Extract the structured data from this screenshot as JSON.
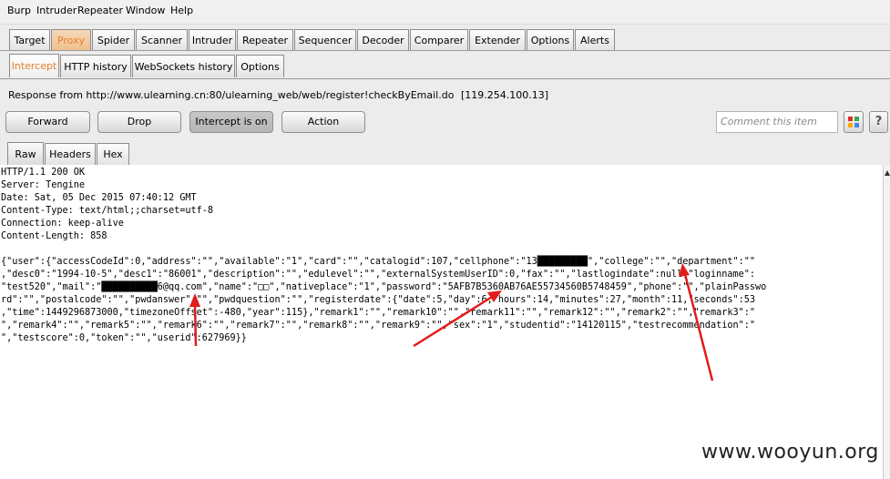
{
  "menu": [
    "Burp",
    "Intruder",
    "Repeater",
    "Window",
    "Help"
  ],
  "main_tabs": [
    "Target",
    "Proxy",
    "Spider",
    "Scanner",
    "Intruder",
    "Repeater",
    "Sequencer",
    "Decoder",
    "Comparer",
    "Extender",
    "Options",
    "Alerts"
  ],
  "proxy_tabs": [
    "Intercept",
    "HTTP history",
    "WebSockets history",
    "Options"
  ],
  "response_label": "Response from http://www.ulearning.cn:80/ulearning_web/web/register!checkByEmail.do",
  "response_ip": "[119.254.100.13]",
  "buttons": {
    "forward": "Forward",
    "drop": "Drop",
    "intercept": "Intercept is on",
    "action": "Action"
  },
  "comment_placeholder": "Comment this item",
  "view_tabs": [
    "Raw",
    "Headers",
    "Hex"
  ],
  "body_lines": [
    "HTTP/1.1 200 OK",
    "Server: Tengine",
    "Date: Sat, 05 Dec 2015 07:40:12 GMT",
    "Content-Type: text/html;;charset=utf-8",
    "Connection: keep-alive",
    "Content-Length: 858",
    "",
    "{\"user\":{\"accessCodeId\":0,\"address\":\"\",\"available\":\"1\",\"card\":\"\",\"catalogid\":107,\"cellphone\":\"13█████████\",\"college\":\"\",\"department\":\"\"",
    ",\"desc0\":\"1994-10-5\",\"desc1\":\"86001\",\"description\":\"\",\"edulevel\":\"\",\"externalSystemUserID\":0,\"fax\":\"\",\"lastlogindate\":null,\"loginname\":",
    "\"test520\",\"mail\":\"██████████6@qq.com\",\"name\":\"□□\",\"nativeplace\":\"1\",\"password\":\"5AFB7B5360AB76AE55734560B5748459\",\"phone\":\"\",\"plainPasswo",
    "rd\":\"\",\"postalcode\":\"\",\"pwdanswer\":\"\",\"pwdquestion\":\"\",\"registerdate\":{\"date\":5,\"day\":6,\"hours\":14,\"minutes\":27,\"month\":11,\"seconds\":53",
    ",\"time\":1449296873000,\"timezoneOffset\":-480,\"year\":115},\"remark1\":\"\",\"remark10\":\"\",\"remark11\":\"\",\"remark12\":\"\",\"remark2\":\"\",\"remark3\":\"",
    "\",\"remark4\":\"\",\"remark5\":\"\",\"remark6\":\"\",\"remark7\":\"\",\"remark8\":\"\",\"remark9\":\"\",\"sex\":\"1\",\"studentid\":\"14120115\",\"testrecommendation\":\"",
    "\",\"testscore\":0,\"token\":\"\",\"userid\":627969}}"
  ],
  "watermark": "www.wooyun.org",
  "colors": {
    "active_tab": "#e5812e",
    "arrow": "#e21b1b"
  }
}
